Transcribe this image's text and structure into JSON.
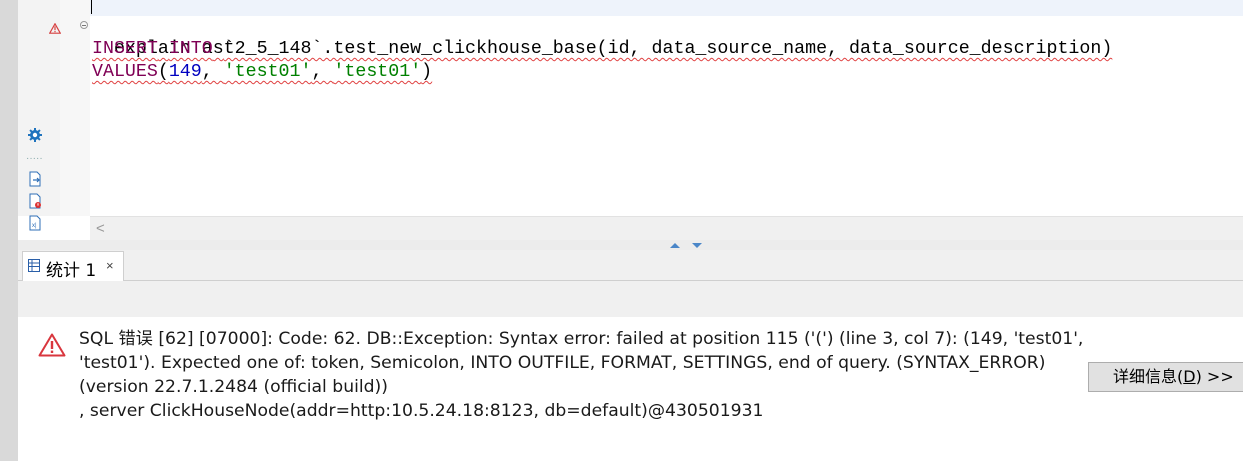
{
  "editor": {
    "lines": {
      "line1": {
        "text": "explain ast"
      },
      "line2": {
        "kw_insert": "INSERT",
        "kw_into": "INTO",
        "rest": "`2_5_148`.test_new_clickhouse_base(id, data_source_name, data_source_description)"
      },
      "line3": {
        "kw_values": "VALUES",
        "open": "(",
        "num": "149",
        "sep1": ", ",
        "str1": "'test01'",
        "sep2": ", ",
        "str2": "'test01'",
        "close": ")"
      }
    },
    "colors": {
      "keyword": "#7f0055",
      "number": "#0000c0",
      "string": "#008000",
      "error_squiggle": "#e04040"
    }
  },
  "side_icons": [
    "settings-icon",
    "export-icon",
    "file-error-icon",
    "excel-icon"
  ],
  "scroll_left_glyph": "<",
  "tabs": [
    {
      "label": "统计 1",
      "close": "×",
      "icon": "grid-table-icon"
    }
  ],
  "error": {
    "icon": "error-triangle-icon",
    "lines": [
      "SQL 错误 [62] [07000]: Code: 62. DB::Exception: Syntax error: failed at position 115 ('(') (line 3, col 7): (149, 'test01',",
      "'test01'). Expected one of: token, Semicolon, INTO OUTFILE, FORMAT, SETTINGS, end of query. (SYNTAX_ERROR)",
      "(version 22.7.1.2484 (official build))",
      ", server ClickHouseNode(addr=http:10.5.24.18:8123, db=default)@430501931"
    ]
  },
  "details_button": {
    "label_pre": "详细信息(",
    "mnemonic": "D",
    "label_post": ") >>"
  }
}
